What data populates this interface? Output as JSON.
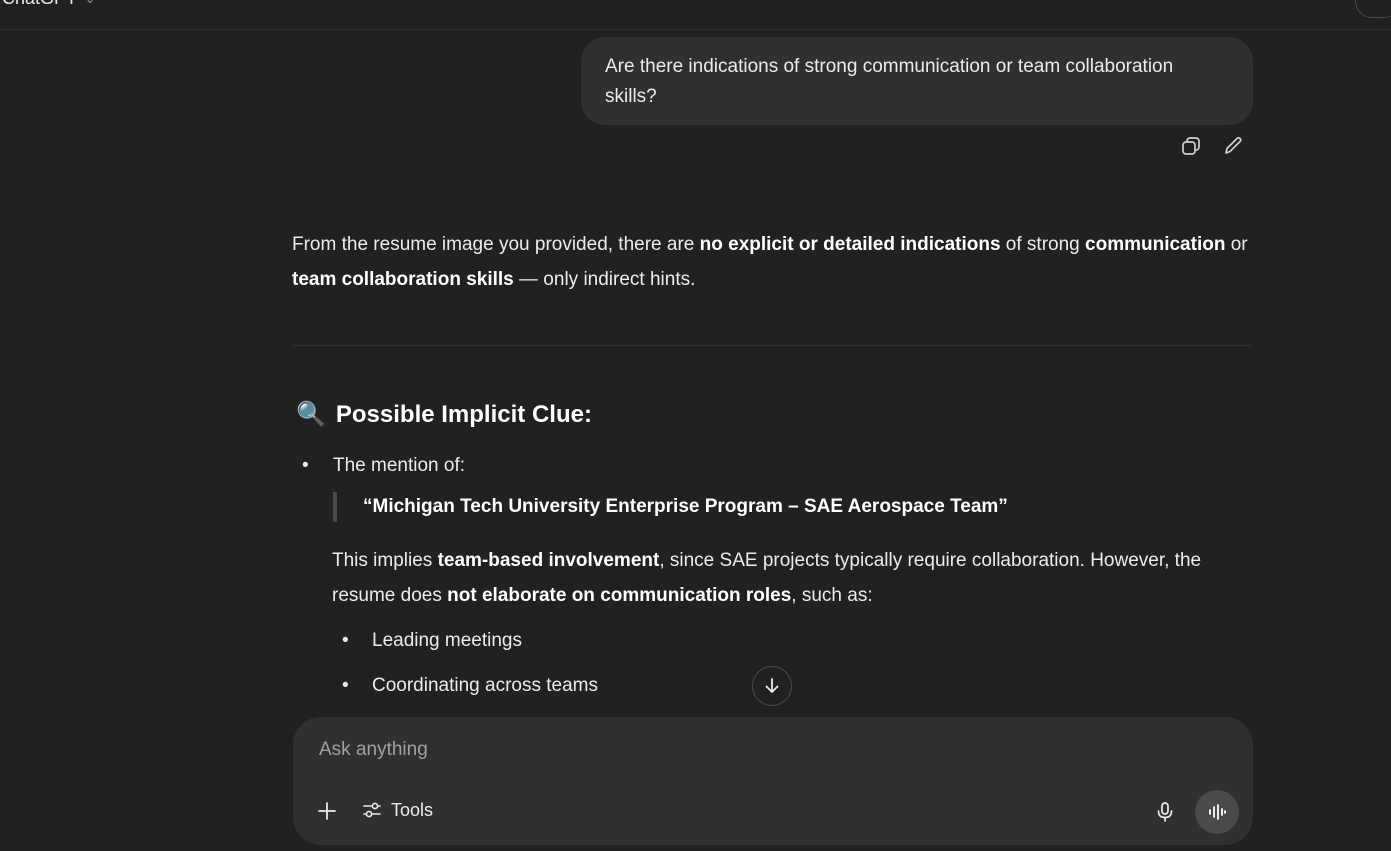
{
  "header": {
    "app_title": "ChatGPT",
    "model_chevron": "chevron-down-icon"
  },
  "user_message": {
    "text": "Are there indications of strong communication or team collaboration skills?",
    "actions": [
      "copy-icon",
      "edit-icon"
    ]
  },
  "assistant": {
    "intro": {
      "t1": "From the resume image you provided, there are ",
      "b1": "no explicit or detailed indications",
      "t2": " of strong ",
      "b2": "communication",
      "t3": " or ",
      "b3": "team collaboration skills",
      "t4": " — only indirect hints."
    },
    "section_heading": {
      "emoji": "🔍",
      "title": "Possible Implicit Clue:"
    },
    "bullet": "The mention of:",
    "quote": "“Michigan Tech University Enterprise Program – SAE Aerospace Team”",
    "para": {
      "t1": "This implies ",
      "b1": "team-based involvement",
      "t2": ", since SAE projects typically require collaboration. However, the resume does ",
      "b2": "not elaborate on communication roles",
      "t3": ", such as:"
    },
    "sub_items": [
      "Leading meetings",
      "Coordinating across teams"
    ]
  },
  "composer": {
    "placeholder": "Ask anything",
    "tools_label": "Tools"
  },
  "colors": {
    "background": "#212121",
    "bubble": "#303030",
    "text": "#ececec"
  }
}
